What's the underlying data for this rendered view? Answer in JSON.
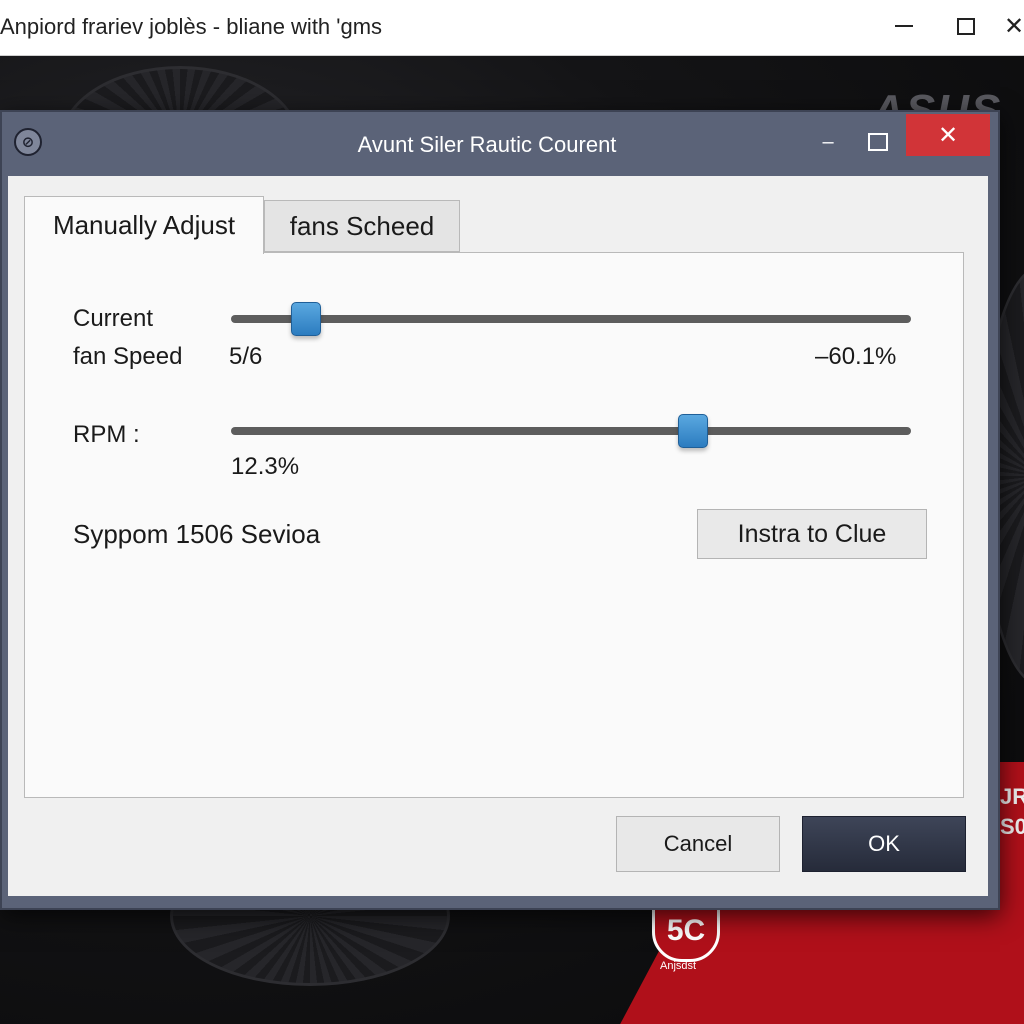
{
  "outer_window": {
    "title": "Anpiord frariev joblès - bliane with 'gms",
    "controls": {
      "minimize": "—",
      "maximize": "☐",
      "close": "✕"
    }
  },
  "background": {
    "brand": "ASUS",
    "right_text_1": "JR",
    "right_text_2": "S0",
    "badge": "5C",
    "badge_label": "Anjsdst"
  },
  "dialog": {
    "title": "Avunt Siler Rautic Courent",
    "controls": {
      "minimize": "–",
      "close": "✕"
    },
    "tabs": [
      {
        "label": "Manually Adjust",
        "active": true
      },
      {
        "label": "fans Scheed",
        "active": false
      }
    ],
    "fan_speed": {
      "label_line1": "Current",
      "label_line2": "fan Speed",
      "value": "5/6",
      "right_value": "–60.1%",
      "slider_level": 0.11
    },
    "rpm": {
      "label": "RPM :",
      "value": "12.3%",
      "slider_level": 0.68
    },
    "status_text": "Sуppom 1506 Sevioa",
    "side_button": "Instra to Clue",
    "cancel_label": "Cancel",
    "ok_label": "OK"
  },
  "colors": {
    "title_bar": "#5b6378",
    "close_button": "#d13438",
    "slider_thumb": "#2c7cc0",
    "ok_button": "#2b3040",
    "background_red": "#b0101a"
  },
  "icons": {
    "dialog_app": "fan-logo-icon",
    "close": "close-icon",
    "minimize": "minimize-icon",
    "maximize": "maximize-icon"
  }
}
